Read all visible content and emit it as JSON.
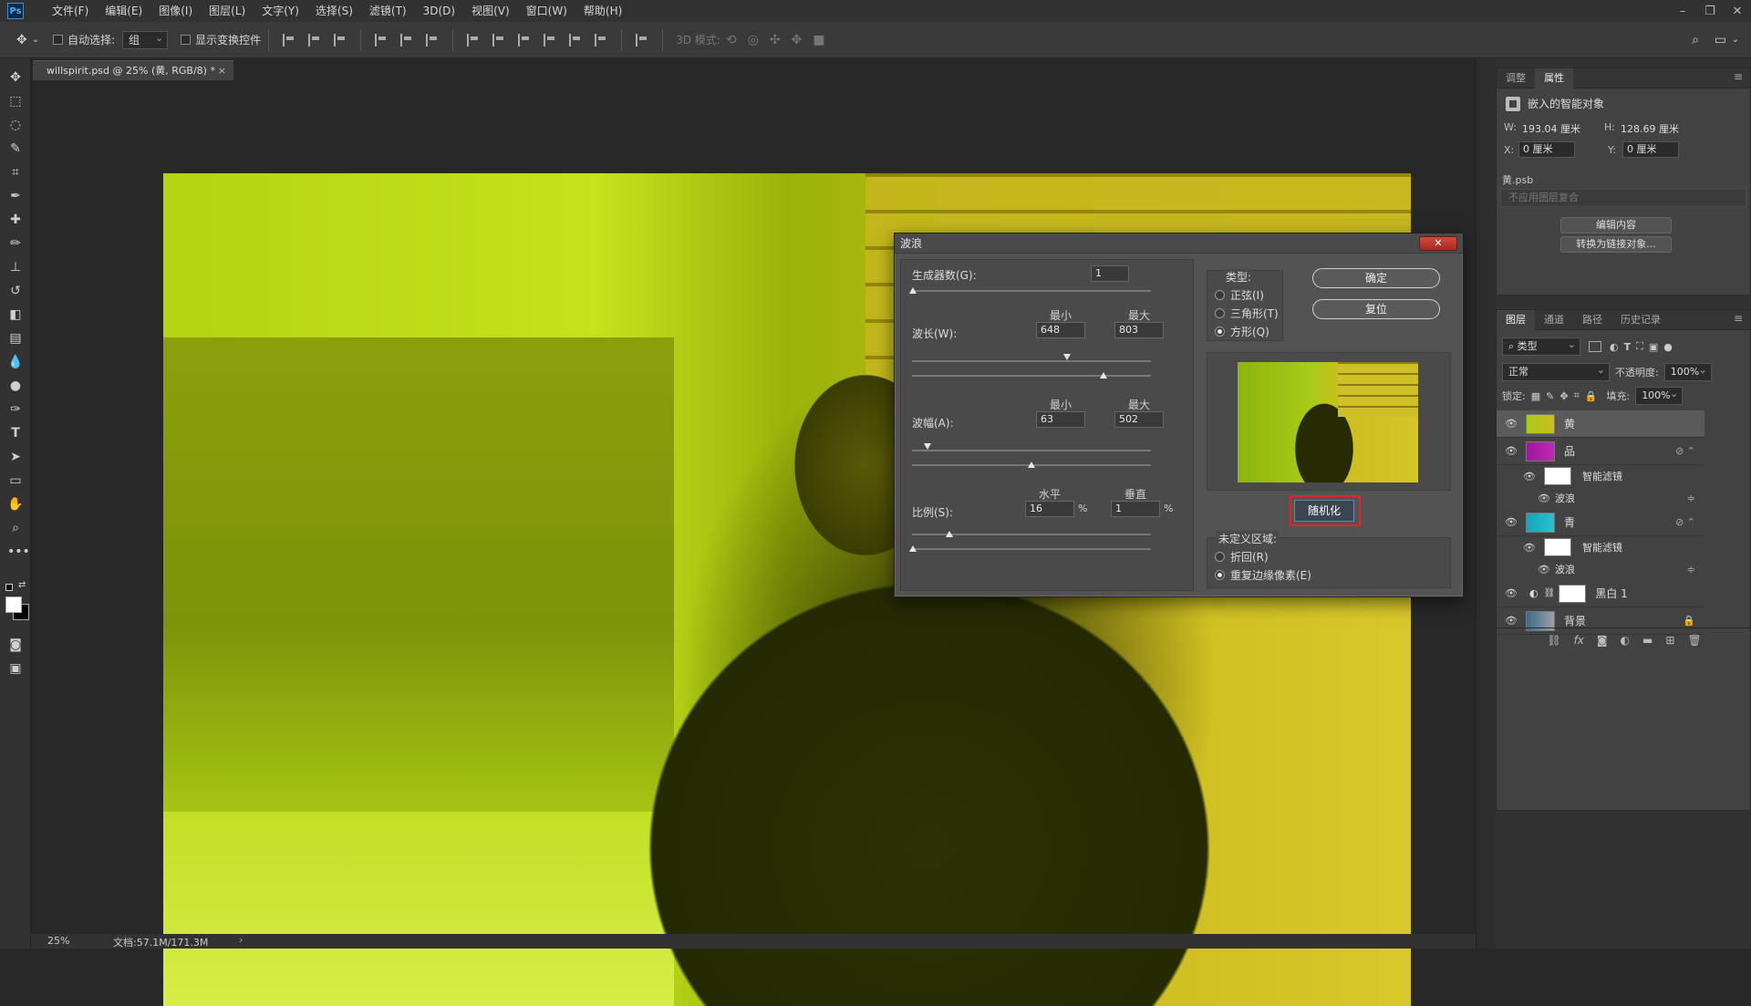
{
  "menubar": {
    "logo": "Ps",
    "items": [
      "文件(F)",
      "编辑(E)",
      "图像(I)",
      "图层(L)",
      "文字(Y)",
      "选择(S)",
      "滤镜(T)",
      "3D(D)",
      "视图(V)",
      "窗口(W)",
      "帮助(H)"
    ],
    "win_minimize": "–",
    "win_restore": "❐",
    "win_close": "✕"
  },
  "options": {
    "auto_select_label": "自动选择:",
    "auto_select_value": "组",
    "show_transform_label": "显示变换控件",
    "mode3d_label": "3D 模式:"
  },
  "document": {
    "tab_title": "willspirit.psd @ 25% (黄, RGB/8) *",
    "tab_close": "×"
  },
  "status": {
    "zoom": "25%",
    "doc_size": "文档:57.1M/171.3M",
    "arrow": "›"
  },
  "properties": {
    "tabs": [
      "调整",
      "属性"
    ],
    "active_tab": "属性",
    "object_type": "嵌入的智能对象",
    "w_label": "W:",
    "w_value": "193.04 厘米",
    "h_label": "H:",
    "h_value": "128.69 厘米",
    "x_label": "X:",
    "x_value": "0 厘米",
    "y_label": "Y:",
    "y_value": "0 厘米",
    "file_name": "黄.psb",
    "layer_comp": "不应用图层复合",
    "edit_contents": "编辑内容",
    "convert_linked": "转换为链接对象..."
  },
  "layers": {
    "tabs": [
      "图层",
      "通道",
      "路径",
      "历史记录"
    ],
    "active_tab": "图层",
    "filter_kind": "类型",
    "blend_mode": "正常",
    "opacity_label": "不透明度:",
    "opacity_value": "100%",
    "lock_label": "锁定:",
    "fill_label": "填充:",
    "fill_value": "100%",
    "items": [
      {
        "name": "黄",
        "active": true
      },
      {
        "name": "品",
        "active": false
      },
      {
        "name": "智能滤镜",
        "active": false
      },
      {
        "name": "波浪",
        "active": false
      },
      {
        "name": "青",
        "active": false
      },
      {
        "name": "智能滤镜",
        "active": false
      },
      {
        "name": "波浪",
        "active": false
      },
      {
        "name": "黑白 1",
        "active": false
      },
      {
        "name": "背景",
        "active": false
      }
    ]
  },
  "wave_dialog": {
    "title": "波浪",
    "close": "✕",
    "generators_label": "生成器数(G):",
    "generators_value": "1",
    "wavelength_label": "波长(W):",
    "min_label": "最小",
    "max_label": "最大",
    "wavelength_min": "648",
    "wavelength_max": "803",
    "amplitude_label": "波幅(A):",
    "amplitude_min": "63",
    "amplitude_max": "502",
    "scale_label": "比例(S):",
    "horizontal_label": "水平",
    "vertical_label": "垂直",
    "scale_h": "16",
    "scale_v": "1",
    "percent": "%",
    "type_label": "类型:",
    "type_sine": "正弦(I)",
    "type_triangle": "三角形(T)",
    "type_square": "方形(Q)",
    "selected_type": "方形(Q)",
    "ok": "确定",
    "reset": "复位",
    "randomize": "随机化",
    "undefined_area_label": "未定义区域:",
    "wrap_around": "折回(R)",
    "repeat_edge": "重复边缘像素(E)",
    "selected_undefined": "重复边缘像素(E)"
  }
}
